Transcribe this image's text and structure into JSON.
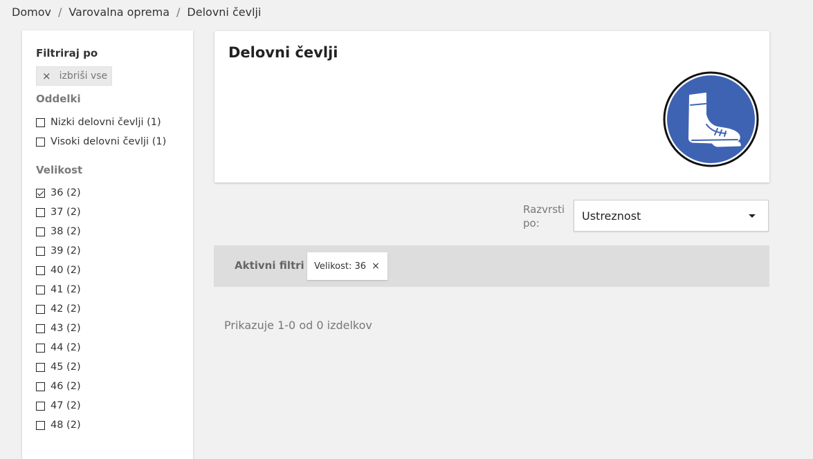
{
  "breadcrumb": {
    "items": [
      "Domov",
      "Varovalna oprema",
      "Delovni čevlji"
    ],
    "separator": "/"
  },
  "sidebar": {
    "title": "Filtriraj po",
    "clear_all": {
      "icon": "close-icon",
      "glyph": "×",
      "label": "izbriši vse"
    },
    "departments": {
      "title": "Oddelki",
      "items": [
        {
          "label": "Nizki delovni čevlji (1)",
          "checked": false
        },
        {
          "label": "Visoki delovni čevlji (1)",
          "checked": false
        }
      ]
    },
    "sizes": {
      "title": "Velikost",
      "items": [
        {
          "label": "36 (2)",
          "checked": true
        },
        {
          "label": "37 (2)",
          "checked": false
        },
        {
          "label": "38 (2)",
          "checked": false
        },
        {
          "label": "39 (2)",
          "checked": false
        },
        {
          "label": "40 (2)",
          "checked": false
        },
        {
          "label": "41 (2)",
          "checked": false
        },
        {
          "label": "42 (2)",
          "checked": false
        },
        {
          "label": "43 (2)",
          "checked": false
        },
        {
          "label": "44 (2)",
          "checked": false
        },
        {
          "label": "45 (2)",
          "checked": false
        },
        {
          "label": "46 (2)",
          "checked": false
        },
        {
          "label": "47 (2)",
          "checked": false
        },
        {
          "label": "48 (2)",
          "checked": false
        }
      ]
    }
  },
  "hero": {
    "title": "Delovni čevlji",
    "sign_icon": "safety-boots-mandatory-sign-icon",
    "sign_color": "#3f63b3"
  },
  "sort": {
    "label_line1": "Razvrsti",
    "label_line2": "po:",
    "value": "Ustreznost",
    "icon": "caret-down-icon"
  },
  "active_filters": {
    "label": "Aktivni filtri",
    "chips": [
      {
        "label": "Velikost: 36",
        "remove_glyph": "×"
      }
    ]
  },
  "results": {
    "text": "Prikazuje 1-0 od 0 izdelkov"
  }
}
